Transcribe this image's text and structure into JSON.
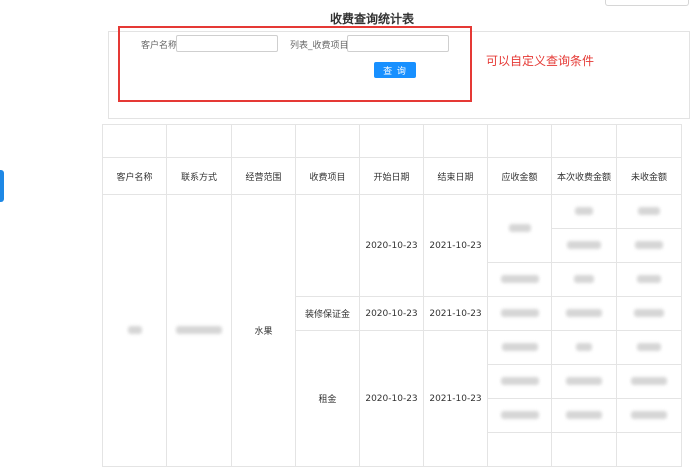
{
  "title": "收费查询统计表",
  "filters": {
    "customer_label": "客户名称",
    "customer_value": "",
    "item_label": "列表_收费项目",
    "item_value": "",
    "query_button": "查 询"
  },
  "annotation": "可以自定义查询条件",
  "table": {
    "headers": [
      "客户名称",
      "联系方式",
      "经营范围",
      "收费项目",
      "开始日期",
      "结束日期",
      "应收金额",
      "本次收费金额",
      "未收金额"
    ],
    "scope": "水果",
    "items": [
      {
        "name": "",
        "start": "2020-10-23",
        "end": "2021-10-23"
      },
      {
        "name": "装修保证金",
        "start": "2020-10-23",
        "end": "2021-10-23"
      },
      {
        "name": "租金",
        "start": "2020-10-23",
        "end": "2021-10-23"
      }
    ]
  },
  "colors": {
    "accent": "#1890ff",
    "highlight": "#e53935"
  }
}
